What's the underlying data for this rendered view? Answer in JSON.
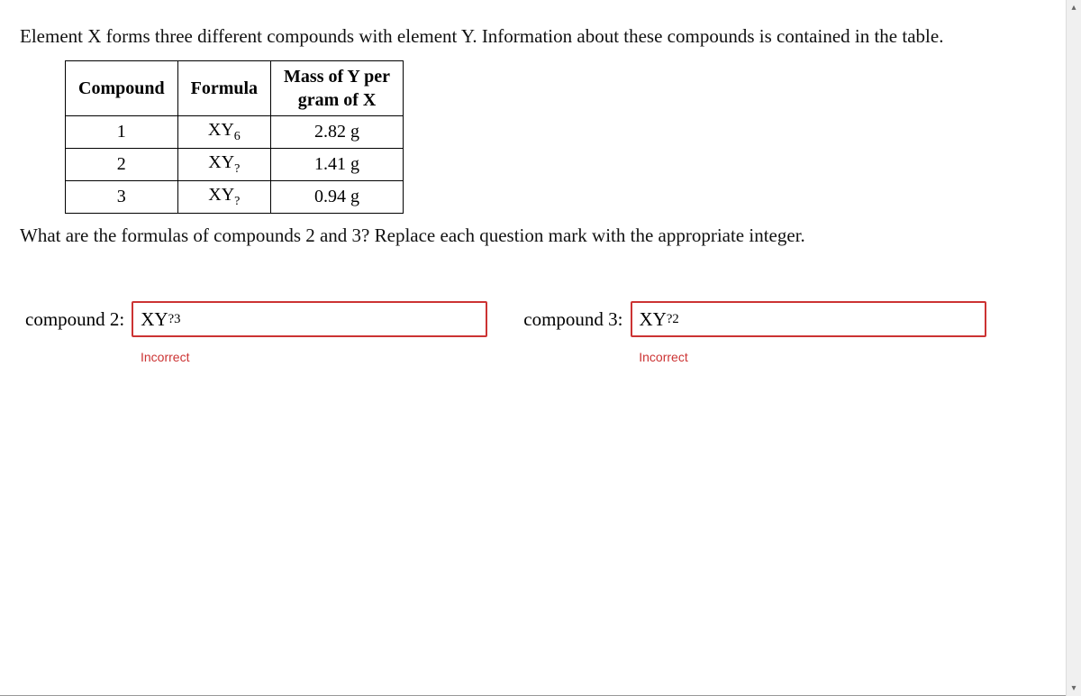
{
  "intro": "Element X forms three different compounds with element Y. Information about these compounds is contained in the table.",
  "table": {
    "headers": {
      "compound": "Compound",
      "formula": "Formula",
      "mass_line1": "Mass of Y per",
      "mass_line2": "gram of X"
    },
    "rows": [
      {
        "compound": "1",
        "formula_base": "XY",
        "formula_sub": "6",
        "mass": "2.82 g"
      },
      {
        "compound": "2",
        "formula_base": "XY",
        "formula_sub": "?",
        "mass": "1.41 g"
      },
      {
        "compound": "3",
        "formula_base": "XY",
        "formula_sub": "?",
        "mass": "0.94 g"
      }
    ]
  },
  "question2": "What are the formulas of compounds 2 and 3? Replace each question mark with the appropriate integer.",
  "answers": {
    "compound2": {
      "label": "compound 2:",
      "value_base": "XY",
      "value_sub": "?3",
      "feedback": "Incorrect"
    },
    "compound3": {
      "label": "compound 3:",
      "value_base": "XY",
      "value_sub": "?2",
      "feedback": "Incorrect"
    }
  },
  "scroll": {
    "up": "▴",
    "down": "▾"
  }
}
